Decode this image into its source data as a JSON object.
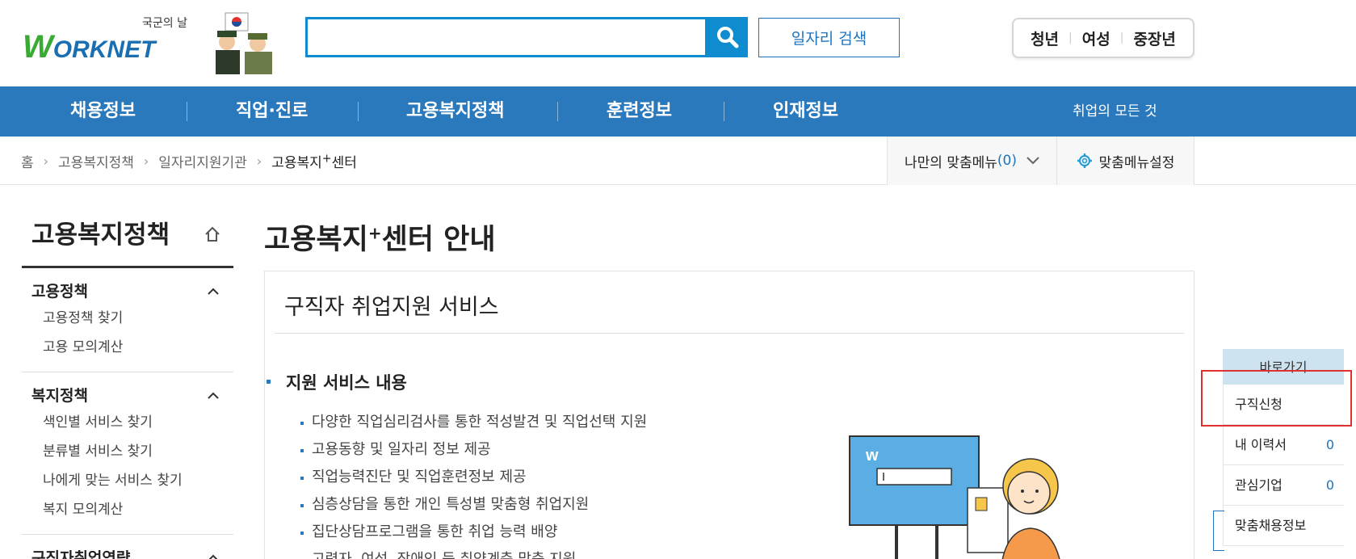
{
  "header": {
    "logo_sub": "국군의 날",
    "logo_text_w": "W",
    "logo_text_rest": "ORKNET",
    "job_search_label": "일자리 검색",
    "target_groups": [
      "청년",
      "여성",
      "중장년"
    ]
  },
  "gnb": {
    "items": [
      "채용정보",
      "직업·진로",
      "고용복지정책",
      "훈련정보",
      "인재정보"
    ],
    "right": "취업의 모든 것"
  },
  "breadcrumb": {
    "items": [
      "홈",
      "고용복지정책",
      "일자리지원기관"
    ],
    "current_main": "고용복지",
    "current_sup": "+",
    "current_tail": "센터"
  },
  "mymenu": {
    "label": "나만의 맞춤메뉴",
    "count": "(0)"
  },
  "menuset": {
    "label": "맞춤메뉴설정"
  },
  "lnb": {
    "title": "고용복지정책",
    "groups": [
      {
        "label": "고용정책",
        "items": [
          "고용정책 찾기",
          "고용 모의계산"
        ]
      },
      {
        "label": "복지정책",
        "items": [
          "색인별 서비스 찾기",
          "분류별 서비스 찾기",
          "나에게 맞는 서비스 찾기",
          "복지 모의계산"
        ]
      },
      {
        "label": "구직자취업역량",
        "items": []
      }
    ]
  },
  "main": {
    "title_main": "고용복지",
    "title_sup": "+",
    "title_tail": "센터 안내",
    "section_title": "구직자 취업지원 서비스",
    "sub_title": "지원 서비스 내용",
    "services": [
      "다양한 직업심리검사를 통한 적성발견 및 직업선택 지원",
      "고용동향 및 일자리 정보 제공",
      "직업능력진단 및 직업훈련정보 제공",
      "심층상담을 통한 개인 특성별 맞춤형 취업지원",
      "집단상담프로그램을 통한 취업 능력 배양",
      "고령자, 여성, 장애인 등 취약계층 맞춤 지원"
    ]
  },
  "quick": {
    "head": "바로가기",
    "items": [
      {
        "label": "구직신청",
        "count": ""
      },
      {
        "label": "내 이력서",
        "count": "0"
      },
      {
        "label": "관심기업",
        "count": "0"
      },
      {
        "label": "맞춤채용정보",
        "count": ""
      }
    ]
  },
  "colors": {
    "brand_blue": "#2b79bd",
    "search_blue": "#0e8ccf",
    "highlight_red": "#e03030"
  }
}
